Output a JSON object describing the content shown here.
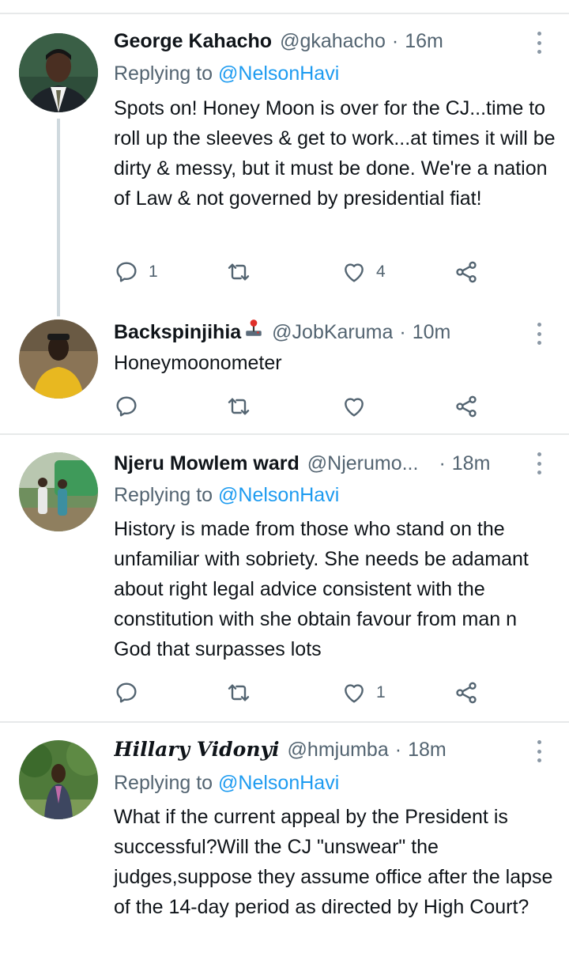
{
  "tweets": [
    {
      "name": "George Kahacho",
      "handle": "@gkahacho",
      "time": "16m",
      "replying_prefix": "Replying to",
      "replying_to": "@NelsonHavi",
      "text": "Spots on! Honey Moon is over for the CJ...time to roll up the sleeves & get to work...at times it will be dirty & messy, but it must be done. We're a nation of Law & not governed by presidential fiat!",
      "replies": "1",
      "retweets": "",
      "likes": "4",
      "avatar_icon": "person-suit-avatar"
    },
    {
      "name": "Backspinjihia",
      "name_emoji": "joystick-emoji",
      "handle": "@JobKaruma",
      "time": "10m",
      "text": "Honeymoonometer",
      "replies": "",
      "retweets": "",
      "likes": "",
      "avatar_icon": "person-yellow-shirt-avatar"
    },
    {
      "name": "Njeru Mowlem ward",
      "handle": "@Njerumo...",
      "time": "18m",
      "replying_prefix": "Replying to",
      "replying_to": "@NelsonHavi",
      "text": "History is made from those who stand on the unfamiliar with sobriety. She needs be adamant about right legal advice consistent with the constitution with she obtain favour from man n God that surpasses lots",
      "replies": "",
      "retweets": "",
      "likes": "1",
      "avatar_icon": "group-outdoor-avatar"
    },
    {
      "name": "Hillary Vidonyi",
      "handle": "@hmjumba",
      "time": "18m",
      "replying_prefix": "Replying to",
      "replying_to": "@NelsonHavi",
      "text": "What if the current appeal by the President is successful?Will the CJ \"unswear\" the judges,suppose they assume office after the lapse of the 14-day period as directed by High Court?",
      "avatar_icon": "person-garden-avatar"
    }
  ],
  "separator_dot": "·",
  "colors": {
    "text": "#0f1419",
    "secondary": "#536471",
    "link": "#1d9bf0",
    "divider": "#e7e9ea"
  }
}
